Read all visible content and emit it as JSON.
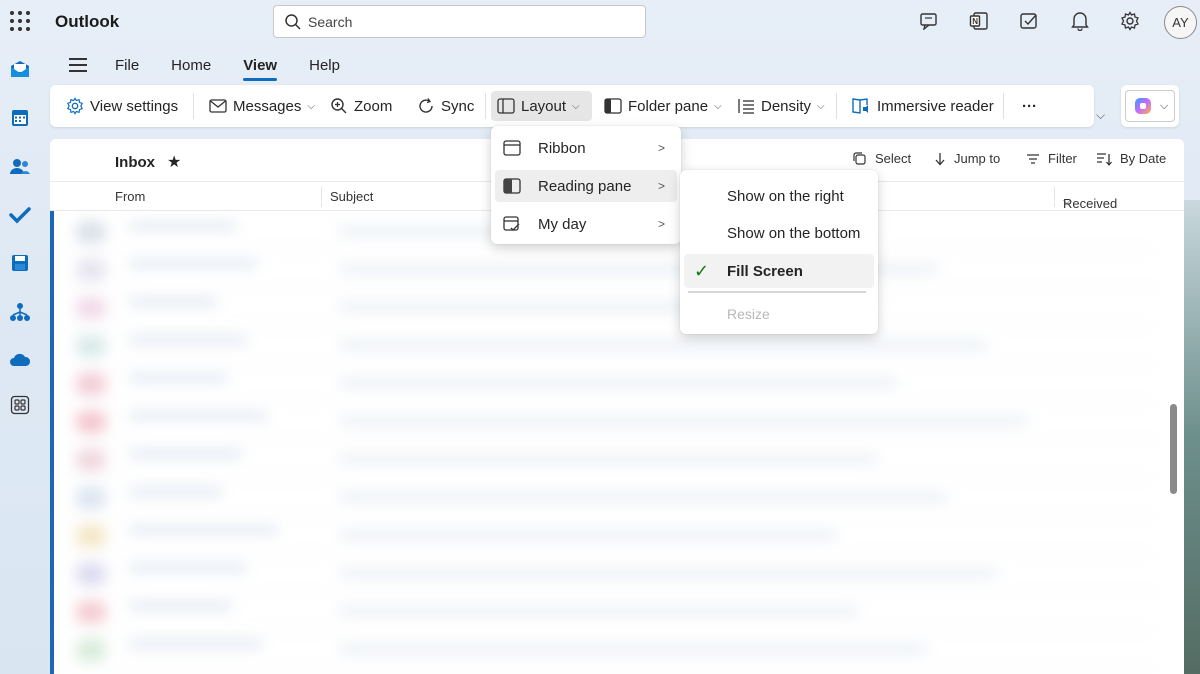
{
  "app": {
    "title": "Outlook"
  },
  "search": {
    "placeholder": "Search"
  },
  "user": {
    "initials": "AY"
  },
  "top_icons": [
    "feedback-icon",
    "onenote-icon",
    "todo-note-icon",
    "bell-icon",
    "gear-icon"
  ],
  "left_rail": [
    "mail-icon",
    "calendar-icon",
    "people-icon",
    "todo-icon",
    "save-icon",
    "org-icon",
    "onedrive-icon",
    "apps-icon"
  ],
  "menu": {
    "tabs": [
      "File",
      "Home",
      "View",
      "Help"
    ],
    "active": "View"
  },
  "ribbon": {
    "view_settings": "View settings",
    "messages": "Messages",
    "zoom": "Zoom",
    "sync": "Sync",
    "layout": "Layout",
    "folder_pane": "Folder pane",
    "density": "Density",
    "immersive_reader": "Immersive reader",
    "more": "···"
  },
  "mail": {
    "folder": "Inbox",
    "tools": {
      "select": "Select",
      "jump_to": "Jump to",
      "filter": "Filter",
      "sort": "By Date"
    },
    "columns": {
      "from": "From",
      "subject": "Subject",
      "received": "Received"
    }
  },
  "layout_menu": {
    "items": [
      "Ribbon",
      "Reading pane",
      "My day"
    ],
    "hovered": "Reading pane"
  },
  "reading_pane_menu": {
    "items": [
      "Show on the right",
      "Show on the bottom",
      "Fill Screen"
    ],
    "selected": "Fill Screen",
    "disabled_item": "Resize"
  },
  "colors": {
    "accent": "#0f6cbd",
    "check": "#107c10",
    "unread_bar": "#1a67b8"
  }
}
